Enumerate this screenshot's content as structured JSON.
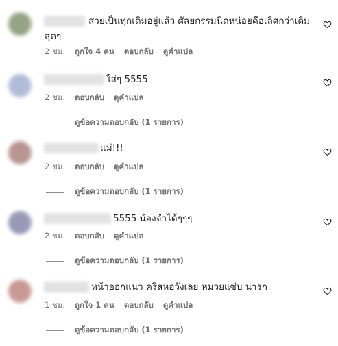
{
  "comments": [
    {
      "text_line1": "สวยเป็นทุกเดิมอยู่แล้ว ศัลยกรรมนิดหน่อยคือเลิศกว่าเดิม",
      "text_line2": "สุดๆ",
      "time": "2 ชม.",
      "likes": "ถูกใจ 4 คน",
      "reply": "ตอบกลับ",
      "translate": "ดูคำแปล",
      "avatar_color": "#8a9a7a"
    },
    {
      "text_line1": "ใส่ๆ 5555",
      "time": "2 ชม.",
      "reply": "ตอบกลับ",
      "translate": "ดูคำแปล",
      "view_replies": "ดูข้อความตอบกลับ (1 รายการ)",
      "avatar_color": "#a9b6d4"
    },
    {
      "text_line1": "แม่!!!",
      "time": "2 ชม.",
      "reply": "ตอบกลับ",
      "translate": "ดูคำแปล",
      "view_replies": "ดูข้อความตอบกลับ (1 รายการ)",
      "avatar_color": "#b08a86"
    },
    {
      "text_line1": "5555 น้องจำได้ๆๆๆ",
      "time": "2 ชม.",
      "reply": "ตอบกลับ",
      "translate": "ดูคำแปล",
      "view_replies": "ดูข้อความตอบกลับ (1 รายการ)",
      "avatar_color": "#8d8fb0"
    },
    {
      "text_line1": "หน้าออกแนว คริสหอวังเลย หมวยแซ่บ น่ารก",
      "time": "1 ชม.",
      "likes": "ถูกใจ 1 คน",
      "reply": "ตอบกลับ",
      "translate": "ดูคำแปล",
      "view_replies": "ดูข้อความตอบกลับ (1 รายการ)",
      "avatar_color": "#c28f8a"
    }
  ]
}
